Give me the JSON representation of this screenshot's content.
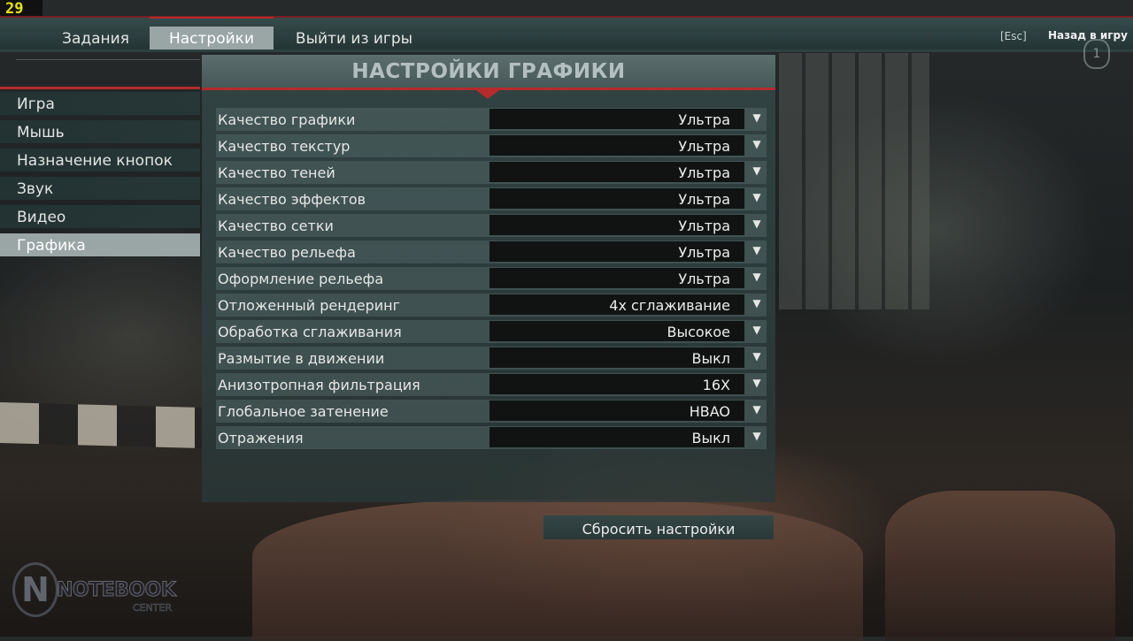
{
  "fps": "29",
  "nav": {
    "tabs": [
      {
        "label": "Задания"
      },
      {
        "label": "Настройки"
      },
      {
        "label": "Выйти из игры"
      }
    ],
    "esc_hint": "[Esc]",
    "back_label": "Назад в игру",
    "badge_glyph": "1"
  },
  "sidebar": {
    "items": [
      {
        "label": "Игра"
      },
      {
        "label": "Мышь"
      },
      {
        "label": "Назначение кнопок"
      },
      {
        "label": "Звук"
      },
      {
        "label": "Видео"
      },
      {
        "label": "Графика"
      }
    ],
    "active_index": 5
  },
  "panel": {
    "title": "НАСТРОЙКИ ГРАФИКИ",
    "settings": [
      {
        "label": "Качество графики",
        "value": "Ультра"
      },
      {
        "label": "Качество текстур",
        "value": "Ультра"
      },
      {
        "label": "Качество теней",
        "value": "Ультра"
      },
      {
        "label": "Качество эффектов",
        "value": "Ультра"
      },
      {
        "label": "Качество сетки",
        "value": "Ультра"
      },
      {
        "label": "Качество рельефа",
        "value": "Ультра"
      },
      {
        "label": "Оформление рельефа",
        "value": "Ультра"
      },
      {
        "label": "Отложенный рендеринг",
        "value": "4x сглаживание"
      },
      {
        "label": "Обработка сглаживания",
        "value": "Высокое"
      },
      {
        "label": "Размытие в движении",
        "value": "Выкл"
      },
      {
        "label": "Анизотропная фильтрация",
        "value": "16X"
      },
      {
        "label": "Глобальное затенение",
        "value": "HBAO"
      },
      {
        "label": "Отражения",
        "value": "Выкл"
      }
    ],
    "reset_label": "Сбросить настройки"
  },
  "watermark": {
    "logo_letter": "N",
    "text": "NOTEBOOK",
    "subtext": "CENTER"
  },
  "colors": {
    "accent_red": "#b52b2c",
    "active_tab_bg": "#9aa5a5",
    "fps_color": "#e8e800"
  }
}
